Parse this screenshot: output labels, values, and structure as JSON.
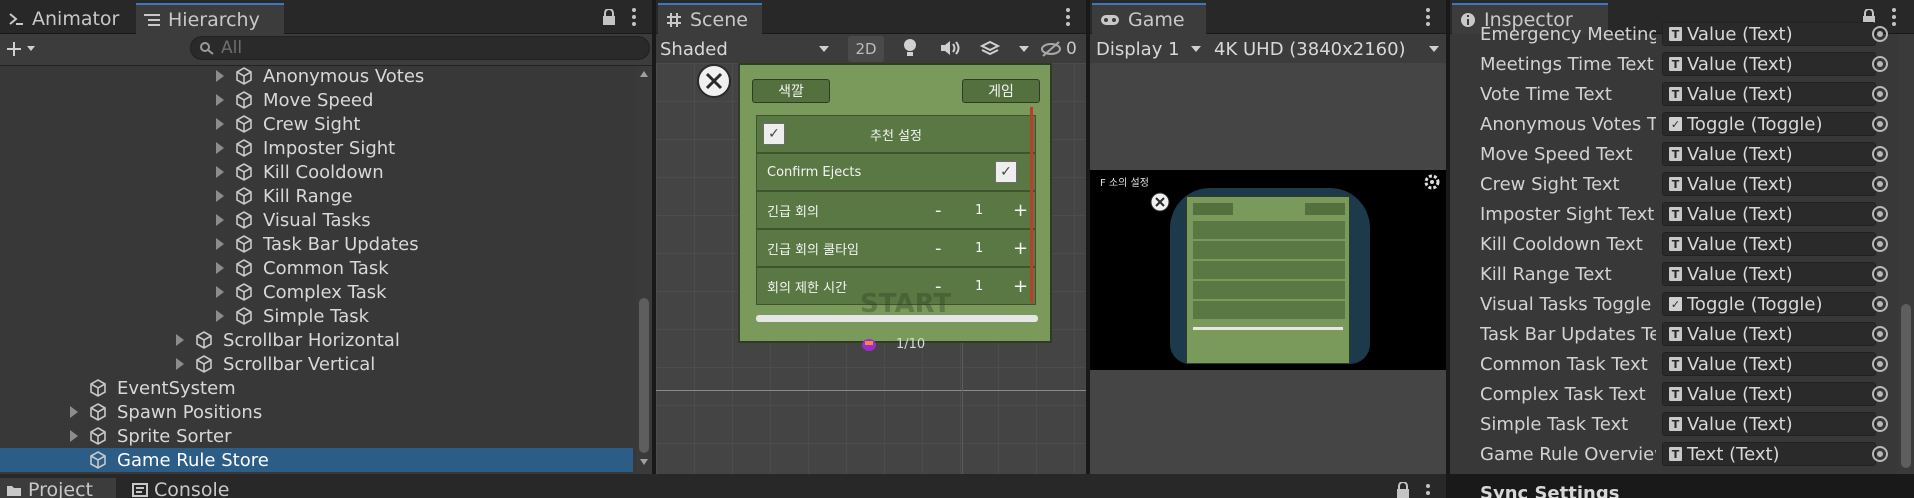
{
  "hierarchy": {
    "tabs": [
      {
        "label": "Animator"
      },
      {
        "label": "Hierarchy"
      }
    ],
    "search_placeholder": "All",
    "items": [
      {
        "label": "Anonymous Votes"
      },
      {
        "label": "Move Speed"
      },
      {
        "label": "Crew Sight"
      },
      {
        "label": "Imposter Sight"
      },
      {
        "label": "Kill Cooldown"
      },
      {
        "label": "Kill Range"
      },
      {
        "label": "Visual Tasks"
      },
      {
        "label": "Task Bar Updates"
      },
      {
        "label": "Common Task"
      },
      {
        "label": "Complex Task"
      },
      {
        "label": "Simple Task"
      },
      {
        "label": "Scrollbar Horizontal"
      },
      {
        "label": "Scrollbar Vertical"
      },
      {
        "label": "EventSystem"
      },
      {
        "label": "Spawn Positions"
      },
      {
        "label": "Sprite Sorter"
      },
      {
        "label": "Game Rule Store"
      }
    ],
    "selected": "Game Rule Store"
  },
  "scene": {
    "tab": "Scene",
    "shading": "Shaded",
    "mode_2d": "2D",
    "hidden_count": "0",
    "ui": {
      "tab_color": "색깔",
      "tab_game": "게임",
      "header": "추천 설정",
      "rows": [
        {
          "label": "Confirm Ejects"
        },
        {
          "label": "긴급 회의",
          "minus": "-",
          "value": "1",
          "plus": "+"
        },
        {
          "label": "긴급 회의 쿨타임",
          "minus": "-",
          "value": "1",
          "plus": "+"
        },
        {
          "label": "회의 제한 시간",
          "minus": "-",
          "value": "1",
          "plus": "+"
        }
      ],
      "start": "START",
      "players": "1/10"
    }
  },
  "game": {
    "tab": "Game",
    "display": "Display 1",
    "resolution": "4K UHD (3840x2160)",
    "room_title": "F 소의 설정"
  },
  "inspector": {
    "tab": "Inspector",
    "rows": [
      {
        "label": "Emergency Meetings",
        "type": "T",
        "value": "Value (Text)"
      },
      {
        "label": "Meetings Time Text",
        "type": "T",
        "value": "Value (Text)"
      },
      {
        "label": "Vote Time Text",
        "type": "T",
        "value": "Value (Text)"
      },
      {
        "label": "Anonymous Votes To",
        "type": "toggle",
        "value": "Toggle (Toggle)"
      },
      {
        "label": "Move Speed Text",
        "type": "T",
        "value": "Value (Text)"
      },
      {
        "label": "Crew Sight Text",
        "type": "T",
        "value": "Value (Text)"
      },
      {
        "label": "Imposter Sight Text",
        "type": "T",
        "value": "Value (Text)"
      },
      {
        "label": "Kill Cooldown Text",
        "type": "T",
        "value": "Value (Text)"
      },
      {
        "label": "Kill Range Text",
        "type": "T",
        "value": "Value (Text)"
      },
      {
        "label": "Visual Tasks Toggle",
        "type": "toggle",
        "value": "Toggle (Toggle)"
      },
      {
        "label": "Task Bar Updates Te",
        "type": "T",
        "value": "Value (Text)"
      },
      {
        "label": "Common Task Text",
        "type": "T",
        "value": "Value (Text)"
      },
      {
        "label": "Complex Task Text",
        "type": "T",
        "value": "Value (Text)"
      },
      {
        "label": "Simple Task Text",
        "type": "T",
        "value": "Value (Text)"
      },
      {
        "label": "Game Rule Overview",
        "type": "T",
        "value": "Text (Text)"
      }
    ],
    "section": "Sync Settings"
  },
  "bottom": {
    "tabs": [
      {
        "label": "Project"
      },
      {
        "label": "Console"
      }
    ]
  }
}
